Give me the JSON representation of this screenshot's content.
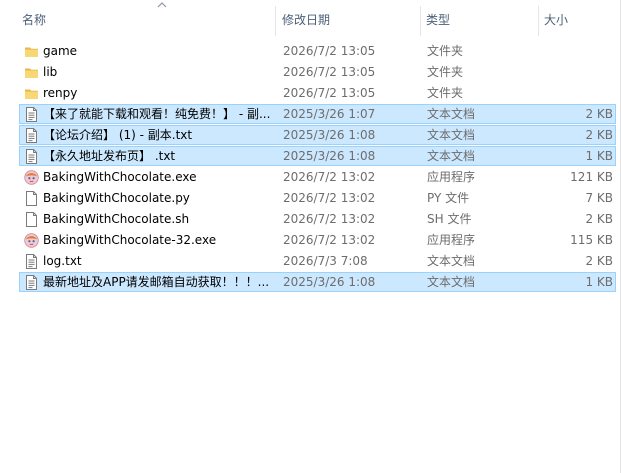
{
  "columns": {
    "name": "名称",
    "date": "修改日期",
    "type": "类型",
    "size": "大小"
  },
  "files": [
    {
      "name": "game",
      "date": "2026/7/2 13:05",
      "type": "文件夹",
      "size": "",
      "icon": "folder-icon",
      "selected": false
    },
    {
      "name": "lib",
      "date": "2026/7/2 13:05",
      "type": "文件夹",
      "size": "",
      "icon": "folder-icon",
      "selected": false
    },
    {
      "name": "renpy",
      "date": "2026/7/2 13:05",
      "type": "文件夹",
      "size": "",
      "icon": "folder-icon",
      "selected": false
    },
    {
      "name": "【来了就能下载和观看！纯免费！】 - 副...",
      "date": "2025/3/26 1:07",
      "type": "文本文档",
      "size": "2 KB",
      "icon": "text-file-icon",
      "selected": true
    },
    {
      "name": "【论坛介绍】 (1) - 副本.txt",
      "date": "2025/3/26 1:08",
      "type": "文本文档",
      "size": "2 KB",
      "icon": "text-file-icon",
      "selected": true
    },
    {
      "name": "【永久地址发布页】 .txt",
      "date": "2025/3/26 1:08",
      "type": "文本文档",
      "size": "1 KB",
      "icon": "text-file-icon",
      "selected": true
    },
    {
      "name": "BakingWithChocolate.exe",
      "date": "2026/7/2 13:02",
      "type": "应用程序",
      "size": "121 KB",
      "icon": "app-icon",
      "selected": false
    },
    {
      "name": "BakingWithChocolate.py",
      "date": "2026/7/2 13:02",
      "type": "PY 文件",
      "size": "7 KB",
      "icon": "blank-file-icon",
      "selected": false
    },
    {
      "name": "BakingWithChocolate.sh",
      "date": "2026/7/2 13:02",
      "type": "SH 文件",
      "size": "2 KB",
      "icon": "blank-file-icon",
      "selected": false
    },
    {
      "name": "BakingWithChocolate-32.exe",
      "date": "2026/7/2 13:02",
      "type": "应用程序",
      "size": "115 KB",
      "icon": "app-icon",
      "selected": false
    },
    {
      "name": "log.txt",
      "date": "2026/7/3 7:08",
      "type": "文本文档",
      "size": "2 KB",
      "icon": "text-file-icon",
      "selected": false
    },
    {
      "name": "最新地址及APP请发邮箱自动获取！！！...",
      "date": "2025/3/26 1:08",
      "type": "文本文档",
      "size": "1 KB",
      "icon": "text-file-icon",
      "selected": true
    }
  ],
  "colors": {
    "selected_bg": "#cce8ff",
    "selected_border": "#99d1ff",
    "header_text": "#4c607a",
    "folder": "#f8d775"
  }
}
